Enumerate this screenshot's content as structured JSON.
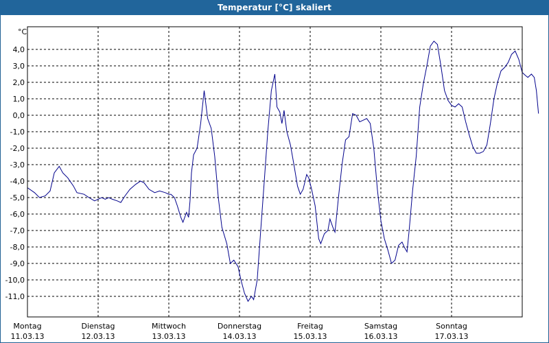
{
  "window": {
    "title": "Temperatur [°C] skaliert"
  },
  "chart_data": {
    "type": "line",
    "title": "Temperatur [°C] skaliert",
    "ylabel": "°C",
    "xlabel": "",
    "ylim": [
      -12,
      5
    ],
    "xlim": [
      0,
      7
    ],
    "grid": true,
    "line_color": "#00008b",
    "yticks": [
      "4,0",
      "3,0",
      "2,0",
      "1,0",
      "0,0",
      "-1,0",
      "-2,0",
      "-3,0",
      "-4,0",
      "-5,0",
      "-6,0",
      "-7,0",
      "-8,0",
      "-9,0",
      "-10,0",
      "-11,0"
    ],
    "ytick_values": [
      4,
      3,
      2,
      1,
      0,
      -1,
      -2,
      -3,
      -4,
      -5,
      -6,
      -7,
      -8,
      -9,
      -10,
      -11
    ],
    "xticks": [
      {
        "day": "Montag",
        "date": "11.03.13"
      },
      {
        "day": "Dienstag",
        "date": "12.03.13"
      },
      {
        "day": "Mittwoch",
        "date": "13.03.13"
      },
      {
        "day": "Donnerstag",
        "date": "14.03.13"
      },
      {
        "day": "Freitag",
        "date": "15.03.13"
      },
      {
        "day": "Samstag",
        "date": "16.03.13"
      },
      {
        "day": "Sonntag",
        "date": "17.03.13"
      }
    ],
    "series": [
      {
        "points": [
          [
            0.0,
            -4.4
          ],
          [
            0.1,
            -4.7
          ],
          [
            0.17,
            -5.0
          ],
          [
            0.25,
            -4.9
          ],
          [
            0.32,
            -4.6
          ],
          [
            0.38,
            -3.5
          ],
          [
            0.45,
            -3.1
          ],
          [
            0.5,
            -3.5
          ],
          [
            0.57,
            -3.8
          ],
          [
            0.65,
            -4.3
          ],
          [
            0.7,
            -4.7
          ],
          [
            0.8,
            -4.8
          ],
          [
            0.87,
            -5.0
          ],
          [
            0.95,
            -5.2
          ],
          [
            1.0,
            -5.1
          ],
          [
            1.05,
            -5.0
          ],
          [
            1.1,
            -5.1
          ],
          [
            1.15,
            -5.0
          ],
          [
            1.2,
            -5.1
          ],
          [
            1.27,
            -5.2
          ],
          [
            1.32,
            -5.3
          ],
          [
            1.38,
            -4.9
          ],
          [
            1.45,
            -4.5
          ],
          [
            1.53,
            -4.2
          ],
          [
            1.6,
            -4.0
          ],
          [
            1.65,
            -4.1
          ],
          [
            1.72,
            -4.5
          ],
          [
            1.8,
            -4.7
          ],
          [
            1.87,
            -4.6
          ],
          [
            1.95,
            -4.7
          ],
          [
            2.0,
            -4.8
          ],
          [
            2.03,
            -4.8
          ],
          [
            2.08,
            -5.0
          ],
          [
            2.12,
            -5.5
          ],
          [
            2.17,
            -6.2
          ],
          [
            2.2,
            -6.5
          ],
          [
            2.25,
            -5.9
          ],
          [
            2.28,
            -6.2
          ],
          [
            2.3,
            -5.2
          ],
          [
            2.32,
            -3.5
          ],
          [
            2.35,
            -2.4
          ],
          [
            2.4,
            -2.0
          ],
          [
            2.45,
            -0.5
          ],
          [
            2.5,
            1.5
          ],
          [
            2.55,
            -0.2
          ],
          [
            2.6,
            -0.8
          ],
          [
            2.65,
            -2.5
          ],
          [
            2.7,
            -5.0
          ],
          [
            2.75,
            -6.8
          ],
          [
            2.82,
            -7.8
          ],
          [
            2.87,
            -9.0
          ],
          [
            2.92,
            -8.8
          ],
          [
            2.98,
            -9.2
          ],
          [
            3.02,
            -10.0
          ],
          [
            3.07,
            -10.8
          ],
          [
            3.12,
            -11.3
          ],
          [
            3.17,
            -11.0
          ],
          [
            3.2,
            -11.2
          ],
          [
            3.25,
            -10.0
          ],
          [
            3.3,
            -7.0
          ],
          [
            3.35,
            -4.0
          ],
          [
            3.4,
            -1.0
          ],
          [
            3.45,
            1.5
          ],
          [
            3.5,
            2.5
          ],
          [
            3.53,
            0.5
          ],
          [
            3.57,
            0.2
          ],
          [
            3.6,
            -0.5
          ],
          [
            3.63,
            0.3
          ],
          [
            3.67,
            -1.0
          ],
          [
            3.72,
            -1.8
          ],
          [
            3.77,
            -3.0
          ],
          [
            3.82,
            -4.3
          ],
          [
            3.86,
            -4.8
          ],
          [
            3.9,
            -4.5
          ],
          [
            3.95,
            -3.6
          ],
          [
            3.98,
            -3.8
          ],
          [
            4.02,
            -4.5
          ],
          [
            4.07,
            -5.5
          ],
          [
            4.12,
            -7.5
          ],
          [
            4.15,
            -7.8
          ],
          [
            4.2,
            -7.2
          ],
          [
            4.25,
            -7.0
          ],
          [
            4.28,
            -6.3
          ],
          [
            4.32,
            -6.8
          ],
          [
            4.35,
            -7.1
          ],
          [
            4.4,
            -5.0
          ],
          [
            4.45,
            -3.0
          ],
          [
            4.5,
            -1.5
          ],
          [
            4.55,
            -1.3
          ],
          [
            4.6,
            0.1
          ],
          [
            4.65,
            0.0
          ],
          [
            4.7,
            -0.4
          ],
          [
            4.75,
            -0.3
          ],
          [
            4.8,
            -0.2
          ],
          [
            4.85,
            -0.5
          ],
          [
            4.9,
            -2.0
          ],
          [
            4.95,
            -4.5
          ],
          [
            5.0,
            -6.4
          ],
          [
            5.05,
            -7.5
          ],
          [
            5.1,
            -8.2
          ],
          [
            5.15,
            -9.0
          ],
          [
            5.2,
            -8.8
          ],
          [
            5.25,
            -7.9
          ],
          [
            5.3,
            -7.7
          ],
          [
            5.33,
            -8.0
          ],
          [
            5.37,
            -8.3
          ],
          [
            5.4,
            -7.0
          ],
          [
            5.45,
            -4.5
          ],
          [
            5.5,
            -2.5
          ],
          [
            5.55,
            0.5
          ],
          [
            5.6,
            1.9
          ],
          [
            5.65,
            3.0
          ],
          [
            5.7,
            4.2
          ],
          [
            5.75,
            4.5
          ],
          [
            5.8,
            4.3
          ],
          [
            5.85,
            3.0
          ],
          [
            5.9,
            1.5
          ],
          [
            5.95,
            0.9
          ],
          [
            6.0,
            0.6
          ],
          [
            6.05,
            0.5
          ],
          [
            6.1,
            0.7
          ],
          [
            6.15,
            0.5
          ],
          [
            6.2,
            -0.4
          ],
          [
            6.25,
            -1.2
          ],
          [
            6.3,
            -1.9
          ],
          [
            6.35,
            -2.3
          ],
          [
            6.4,
            -2.3
          ],
          [
            6.45,
            -2.2
          ],
          [
            6.5,
            -1.8
          ],
          [
            6.55,
            -0.5
          ],
          [
            6.6,
            1.0
          ],
          [
            6.65,
            2.0
          ],
          [
            6.7,
            2.7
          ],
          [
            6.75,
            2.9
          ],
          [
            6.8,
            3.2
          ],
          [
            6.85,
            3.7
          ],
          [
            6.9,
            3.9
          ],
          [
            6.95,
            3.4
          ],
          [
            7.0,
            2.6
          ],
          [
            7.05,
            2.4
          ],
          [
            7.08,
            2.3
          ],
          [
            7.13,
            2.5
          ],
          [
            7.17,
            2.3
          ],
          [
            7.2,
            1.5
          ],
          [
            7.23,
            0.1
          ]
        ]
      }
    ]
  }
}
